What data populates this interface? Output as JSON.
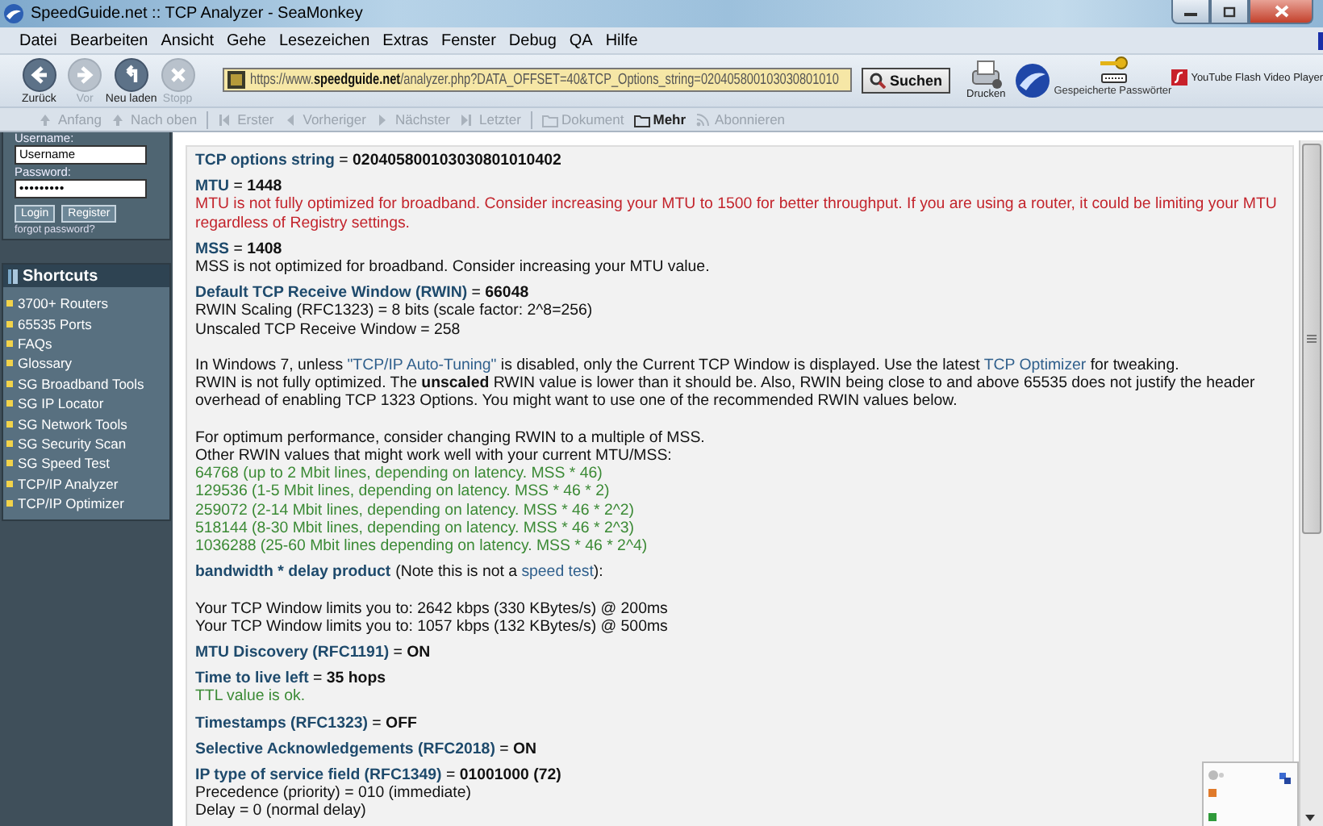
{
  "window": {
    "title": "SpeedGuide.net :: TCP Analyzer - SeaMonkey"
  },
  "menu": [
    "Datei",
    "Bearbeiten",
    "Ansicht",
    "Gehe",
    "Lesezeichen",
    "Extras",
    "Fenster",
    "Debug",
    "QA",
    "Hilfe"
  ],
  "nav_buttons": [
    {
      "label": "Zurück",
      "disabled": false
    },
    {
      "label": "Vor",
      "disabled": true
    },
    {
      "label": "Neu laden",
      "disabled": false
    },
    {
      "label": "Stopp",
      "disabled": true
    }
  ],
  "address_bar": {
    "value": "https://www.**speedguide.net**/analyzer.php?DATA_OFFSET=40&TCP_Options_string=020405800103030801010"
  },
  "search_button": "Suchen",
  "print_button": "Drucken",
  "passwords_button": "Gespeicherte Passwörter",
  "video_button": "YouTube Flash Video Player",
  "site_toolbar": [
    {
      "label": "Anfang",
      "disabled": true
    },
    {
      "label": "Nach oben",
      "disabled": true
    },
    {
      "label": "Erster",
      "disabled": true
    },
    {
      "label": "Vorheriger",
      "disabled": true
    },
    {
      "label": "Nächster",
      "disabled": true
    },
    {
      "label": "Letzter",
      "disabled": true
    },
    {
      "label": "Dokument",
      "disabled": true
    },
    {
      "label": "Mehr",
      "disabled": false
    },
    {
      "label": "Abonnieren",
      "disabled": true
    }
  ],
  "sidebar": {
    "login": {
      "username_label": "Username:",
      "username": "Username",
      "password_label": "Password:",
      "password": "•••••••••",
      "buttons": [
        "Login",
        "Register"
      ],
      "forgot_link": "forgot password?"
    },
    "shortcuts": {
      "title": "Shortcuts",
      "items": [
        "3700+ Routers",
        "65535 Ports",
        "FAQs",
        "Glossary",
        "SG Broadband Tools",
        "SG IP Locator",
        "SG Network Tools",
        "SG Security Scan",
        "SG Speed Test",
        "TCP/IP Analyzer",
        "TCP/IP Optimizer"
      ]
    }
  },
  "report": {
    "sections": [
      {
        "label": "TCP options string",
        "sign": "=",
        "value": "020405800103030801010402"
      },
      {
        "label": "MTU",
        "sign": "=",
        "value": "1448",
        "blocks": [
          {
            "spaced": false,
            "lines": [
              {
                "kind": "warning",
                "parts": [
                  {
                    "kind": "text",
                    "text": "MTU is not fully optimized for broadband. Consider increasing your MTU to 1500 for better throughput. If you are using a router, it could be limiting your MTU regardless of Registry settings."
                  }
                ]
              }
            ]
          }
        ]
      },
      {
        "label": "MSS",
        "sign": "=",
        "value": "1408",
        "blocks": [
          {
            "spaced": false,
            "lines": [
              {
                "kind": "plain",
                "parts": [
                  {
                    "kind": "text",
                    "text": "MSS is not optimized for broadband. Consider increasing your MTU value."
                  }
                ]
              }
            ]
          }
        ]
      },
      {
        "label": "Default TCP Receive Window (RWIN)",
        "sign": "=",
        "value": "66048",
        "blocks": [
          {
            "spaced": false,
            "lines": [
              {
                "kind": "plain",
                "parts": [
                  {
                    "kind": "text",
                    "text": "RWIN Scaling (RFC1323) = 8 bits (scale factor: 2^8=256)"
                  }
                ]
              },
              {
                "kind": "plain",
                "parts": [
                  {
                    "kind": "text",
                    "text": "Unscaled TCP Receive Window = 258"
                  }
                ]
              }
            ]
          },
          {
            "spaced": true,
            "lines": [
              {
                "kind": "plain",
                "parts": [
                  {
                    "kind": "text",
                    "text": "In Windows 7, unless "
                  },
                  {
                    "kind": "link",
                    "text": "\"TCP/IP Auto-Tuning\""
                  },
                  {
                    "kind": "text",
                    "text": " is disabled, only the Current TCP Window is displayed. Use the latest "
                  },
                  {
                    "kind": "link",
                    "text": "TCP Optimizer"
                  },
                  {
                    "kind": "text",
                    "text": " for tweaking."
                  }
                ]
              },
              {
                "kind": "plain",
                "parts": [
                  {
                    "kind": "text",
                    "text": "RWIN is not fully optimized. The **unscaled** RWIN value is lower than it should be. Also, RWIN being close to and above 65535 does not justify the header overhead of enabling TCP 1323 Options. You might want to use one of the recommended RWIN values below."
                  }
                ]
              }
            ]
          },
          {
            "spaced": true,
            "lines": [
              {
                "kind": "plain",
                "parts": [
                  {
                    "kind": "text",
                    "text": "For optimum performance, consider changing RWIN to a multiple of MSS."
                  }
                ]
              },
              {
                "kind": "plain",
                "parts": [
                  {
                    "kind": "text",
                    "text": "Other RWIN values that might work well with your current MTU/MSS:"
                  }
                ]
              },
              {
                "kind": "good",
                "parts": [
                  {
                    "kind": "text",
                    "text": "64768  (up to 2 Mbit lines, depending on latency. MSS * 46)"
                  }
                ]
              },
              {
                "kind": "good",
                "parts": [
                  {
                    "kind": "text",
                    "text": "129536 (1-5 Mbit lines, depending on latency. MSS * 46 * 2)"
                  }
                ]
              },
              {
                "kind": "good",
                "parts": [
                  {
                    "kind": "text",
                    "text": "259072 (2-14 Mbit lines, depending on latency. MSS * 46 * 2^2)"
                  }
                ]
              },
              {
                "kind": "good",
                "parts": [
                  {
                    "kind": "text",
                    "text": "518144 (8-30 Mbit lines, depending on latency. MSS * 46 * 2^3)"
                  }
                ]
              },
              {
                "kind": "good",
                "parts": [
                  {
                    "kind": "text",
                    "text": "1036288 (25-60 Mbit lines depending on latency. MSS * 46 * 2^4)"
                  }
                ]
              }
            ]
          }
        ]
      },
      {
        "label": "bandwidth * delay product",
        "note": [
          {
            "kind": "text",
            "text": "(Note this is not a "
          },
          {
            "kind": "link",
            "text": "speed test"
          },
          {
            "kind": "text",
            "text": "):"
          }
        ],
        "blocks": [
          {
            "spaced": true,
            "lines": [
              {
                "kind": "plain",
                "parts": [
                  {
                    "kind": "text",
                    "text": "Your TCP Window limits you to: 2642 kbps (330 KBytes/s) @ 200ms"
                  }
                ]
              },
              {
                "kind": "plain",
                "parts": [
                  {
                    "kind": "text",
                    "text": "Your TCP Window limits you to: 1057 kbps (132 KBytes/s) @ 500ms"
                  }
                ]
              }
            ]
          }
        ]
      },
      {
        "label": "MTU Discovery (RFC1191)",
        "sign": "=",
        "value": "ON"
      },
      {
        "label": "Time to live left",
        "sign": "=",
        "value": "35 hops",
        "blocks": [
          {
            "spaced": false,
            "lines": [
              {
                "kind": "good",
                "parts": [
                  {
                    "kind": "text",
                    "text": "TTL value is ok."
                  }
                ]
              }
            ]
          }
        ]
      },
      {
        "label": "Timestamps (RFC1323)",
        "sign": "=",
        "value": "OFF"
      },
      {
        "label": "Selective Acknowledgements (RFC2018)",
        "sign": "=",
        "value": "ON"
      },
      {
        "label": "IP type of service field (RFC1349)",
        "sign": "=",
        "value": "01001000 (72)",
        "blocks": [
          {
            "spaced": false,
            "lines": [
              {
                "kind": "plain",
                "parts": [
                  {
                    "kind": "text",
                    "text": "Precedence (priority) = 010 (immediate)"
                  }
                ]
              },
              {
                "kind": "plain",
                "parts": [
                  {
                    "kind": "text",
                    "text": "Delay = 0 (normal delay)"
                  }
                ]
              }
            ]
          }
        ]
      }
    ]
  }
}
